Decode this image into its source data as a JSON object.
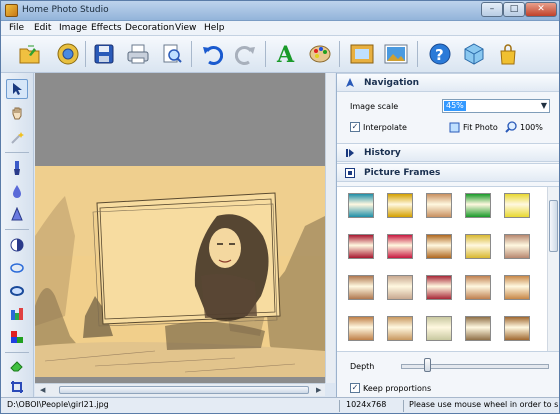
{
  "window": {
    "title": "Home Photo Studio",
    "min_label": "–",
    "max_label": "□",
    "close_label": "✕"
  },
  "menu": [
    "File",
    "Edit",
    "Image",
    "Effects",
    "Decoration",
    "View",
    "Help"
  ],
  "toolbar_icons": [
    "open-folder-icon",
    "gallery-icon",
    "save-icon",
    "print-icon",
    "print-preview-icon",
    "undo-icon",
    "redo-icon",
    "text-icon",
    "palette-icon",
    "frame-icon",
    "photo-icon",
    "help-icon",
    "box-icon",
    "bag-icon"
  ],
  "left_tools": [
    "arrow-icon",
    "hand-icon",
    "magic-wand-icon",
    "brush-icon",
    "drop-icon",
    "cone-icon",
    "contrast-icon",
    "ellipse-icon",
    "ring-icon",
    "levels-icon",
    "color-balance-icon",
    "eraser-icon",
    "crop-icon"
  ],
  "navigation": {
    "title": "Navigation",
    "scale_label": "Image scale",
    "scale_value": "45%",
    "interpolate_label": "Interpolate",
    "interpolate_checked": true,
    "fit_photo_label": "Fit Photo",
    "zoom_100_label": "100%"
  },
  "history": {
    "title": "History"
  },
  "picture_frames": {
    "title": "Picture Frames",
    "frames": [
      "#1f8fa8",
      "#d4a000",
      "#c89060",
      "#1a9a2a",
      "#e8d830",
      "#a81830",
      "#c81840",
      "#b06820",
      "#d8b830",
      "#b88870",
      "#b07850",
      "#c8a890",
      "#a82838",
      "#c08050",
      "#c88848",
      "#c08048",
      "#c89860",
      "#c8c8a0",
      "#907048",
      "#a06830"
    ],
    "depth_label": "Depth",
    "depth_value": 0.16,
    "keep_proportions_label": "Keep proportions",
    "keep_proportions_checked": true
  },
  "status": {
    "path": "D:\\OBOI\\People\\girl21.jpg",
    "size": "1024x768",
    "hint": "Please use mouse wheel in order to s"
  },
  "colors": {
    "accent": "#3399ff",
    "photo_sepia": "#f1cf8b",
    "canvas_bg": "#8c8c8c"
  }
}
